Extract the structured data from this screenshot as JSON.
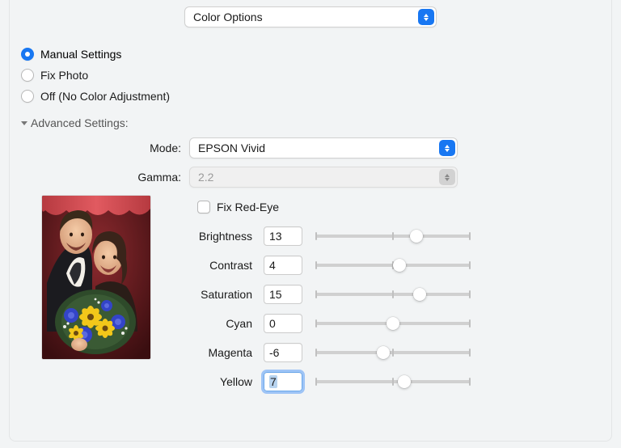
{
  "dropdown": "Color Options",
  "radios": {
    "manual": "Manual Settings",
    "fix_photo": "Fix Photo",
    "off": "Off (No Color Adjustment)"
  },
  "advanced": {
    "header": "Advanced Settings:",
    "mode_label": "Mode:",
    "mode_value": "EPSON Vivid",
    "gamma_label": "Gamma:",
    "gamma_value": "2.2",
    "fix_redeye": "Fix Red-Eye"
  },
  "sliders": {
    "brightness": {
      "label": "Brightness",
      "value": "13",
      "pos_pct": 64
    },
    "contrast": {
      "label": "Contrast",
      "value": "4",
      "pos_pct": 54
    },
    "saturation": {
      "label": "Saturation",
      "value": "15",
      "pos_pct": 66
    },
    "cyan": {
      "label": "Cyan",
      "value": "0",
      "pos_pct": 50
    },
    "magenta": {
      "label": "Magenta",
      "value": "-6",
      "pos_pct": 44
    },
    "yellow": {
      "label": "Yellow",
      "value": "7",
      "pos_pct": 57
    }
  }
}
